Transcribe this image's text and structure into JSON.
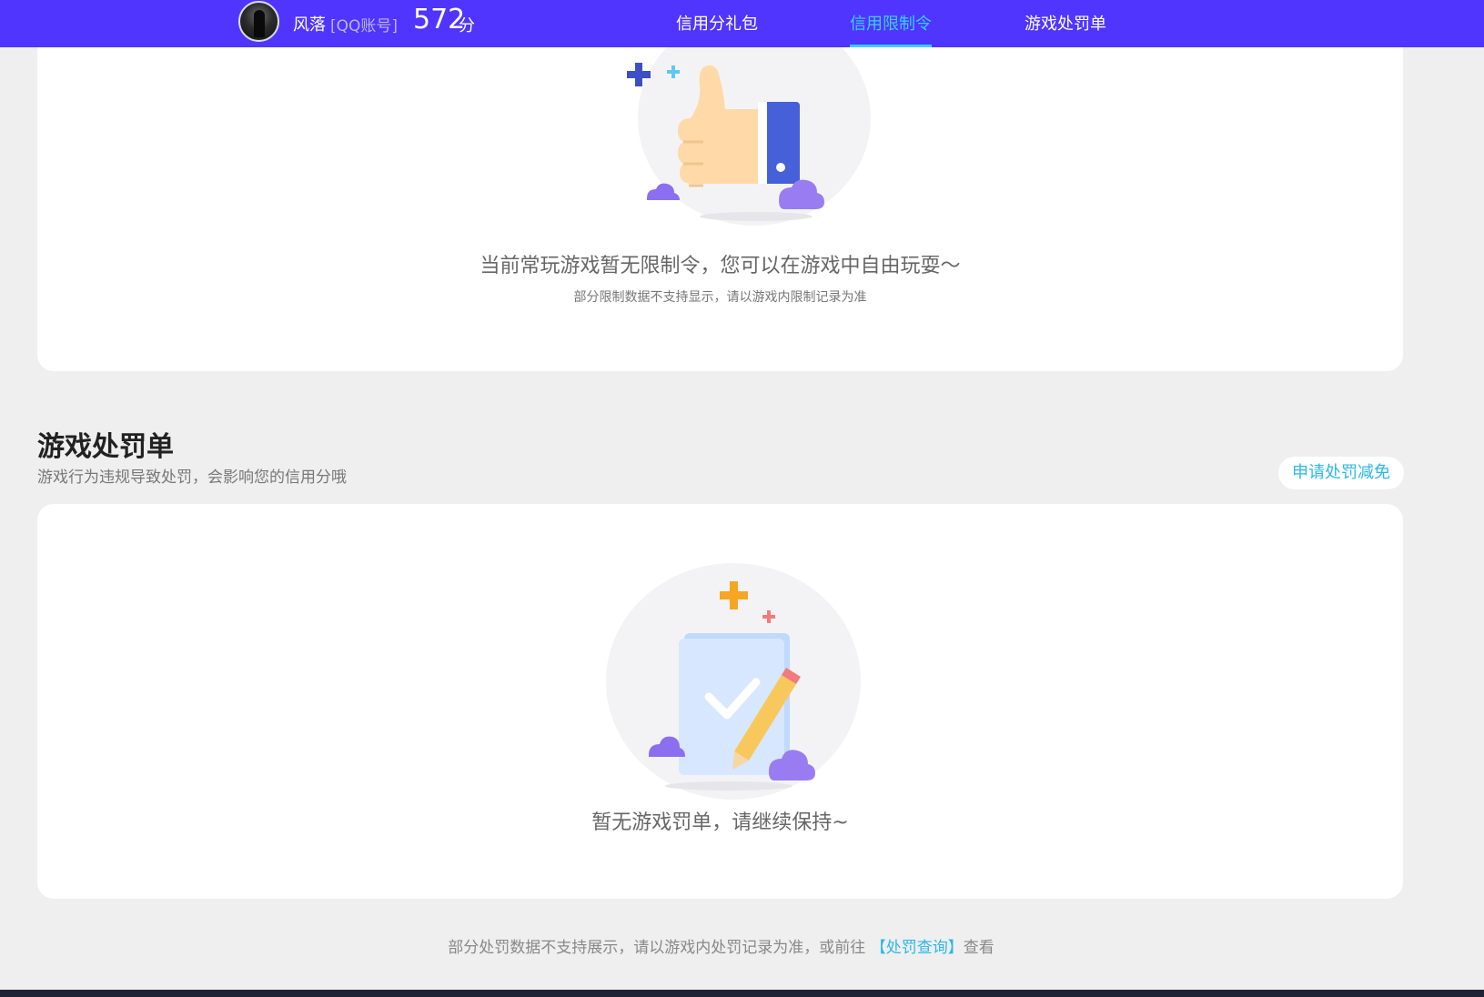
{
  "header": {
    "user_name": "风落",
    "account_type": "[QQ账号]",
    "score": "572",
    "score_unit": "分",
    "tabs": [
      {
        "label": "信用分礼包",
        "active": false
      },
      {
        "label": "信用限制令",
        "active": true
      },
      {
        "label": "游戏处罚单",
        "active": false
      }
    ]
  },
  "restriction": {
    "empty_title": "当前常玩游戏暂无限制令，您可以在游戏中自由玩耍～",
    "empty_note": "部分限制数据不支持显示，请以游戏内限制记录为准"
  },
  "penalty": {
    "title": "游戏处罚单",
    "description": "游戏行为违规导致处罚，会影响您的信用分哦",
    "appeal_button": "申请处罚减免",
    "empty_title": "暂无游戏罚单，请继续保持~"
  },
  "footer": {
    "note_prefix": "部分处罚数据不支持展示，请以游戏内处罚记录为准，或前往 ",
    "link_text": "【处罚查询】",
    "note_suffix": "查看"
  },
  "colors": {
    "header_bg": "#4f35ff",
    "accent": "#39d0ff",
    "link": "#2bb8ea",
    "page_bg": "#efefef"
  }
}
